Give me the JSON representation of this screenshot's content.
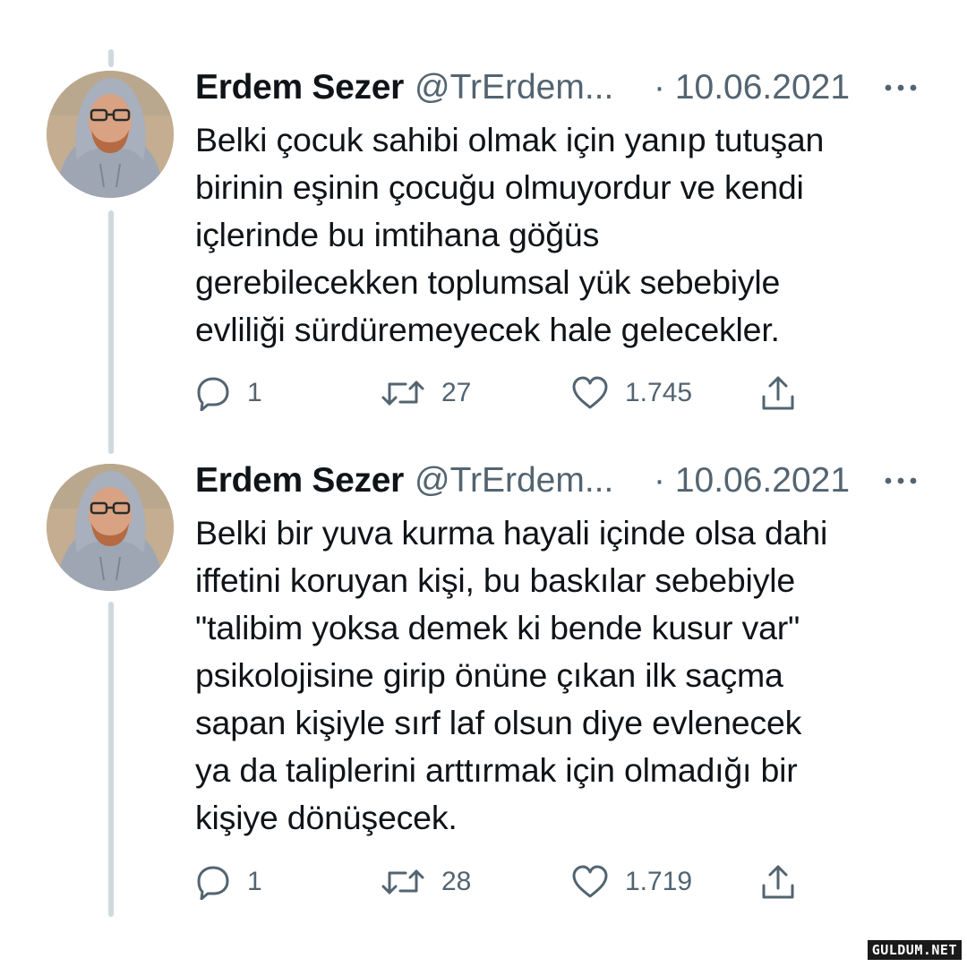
{
  "tweets": [
    {
      "name": "Erdem Sezer",
      "handle": "@TrErdem...",
      "date": "· 10.06.2021",
      "text": "Belki çocuk sahibi olmak için yanıp tutuşan\nbirinin eşinin çocuğu olmuyordur ve kendi\niçlerinde bu imtihana göğüs\ngerebilecekken toplumsal yük sebebiyle\nevliliği sürdüremeyecek hale gelecekler.",
      "replies": "1",
      "retweets": "27",
      "likes": "1.745"
    },
    {
      "name": "Erdem Sezer",
      "handle": "@TrErdem...",
      "date": "· 10.06.2021",
      "text": "Belki bir yuva kurma hayali içinde olsa dahi\niffetini koruyan kişi, bu baskılar sebebiyle\n\"talibim yoksa demek ki bende kusur var\"\npsikolojisine girip önüne çıkan ilk saçma\nsapan kişiyle sırf laf olsun diye evlenecek\nya da taliplerini arttırmak için olmadığı bir\nkişiye dönüşecek.",
      "replies": "1",
      "retweets": "28",
      "likes": "1.719"
    }
  ],
  "watermark": "GULDUM.NET",
  "icons": {
    "reply": "reply-icon",
    "retweet": "retweet-icon",
    "like": "heart-icon",
    "share": "share-icon",
    "more": "more-icon"
  },
  "colors": {
    "text": "#0f1419",
    "secondary": "#536471",
    "thread_line": "#cfd9de"
  }
}
